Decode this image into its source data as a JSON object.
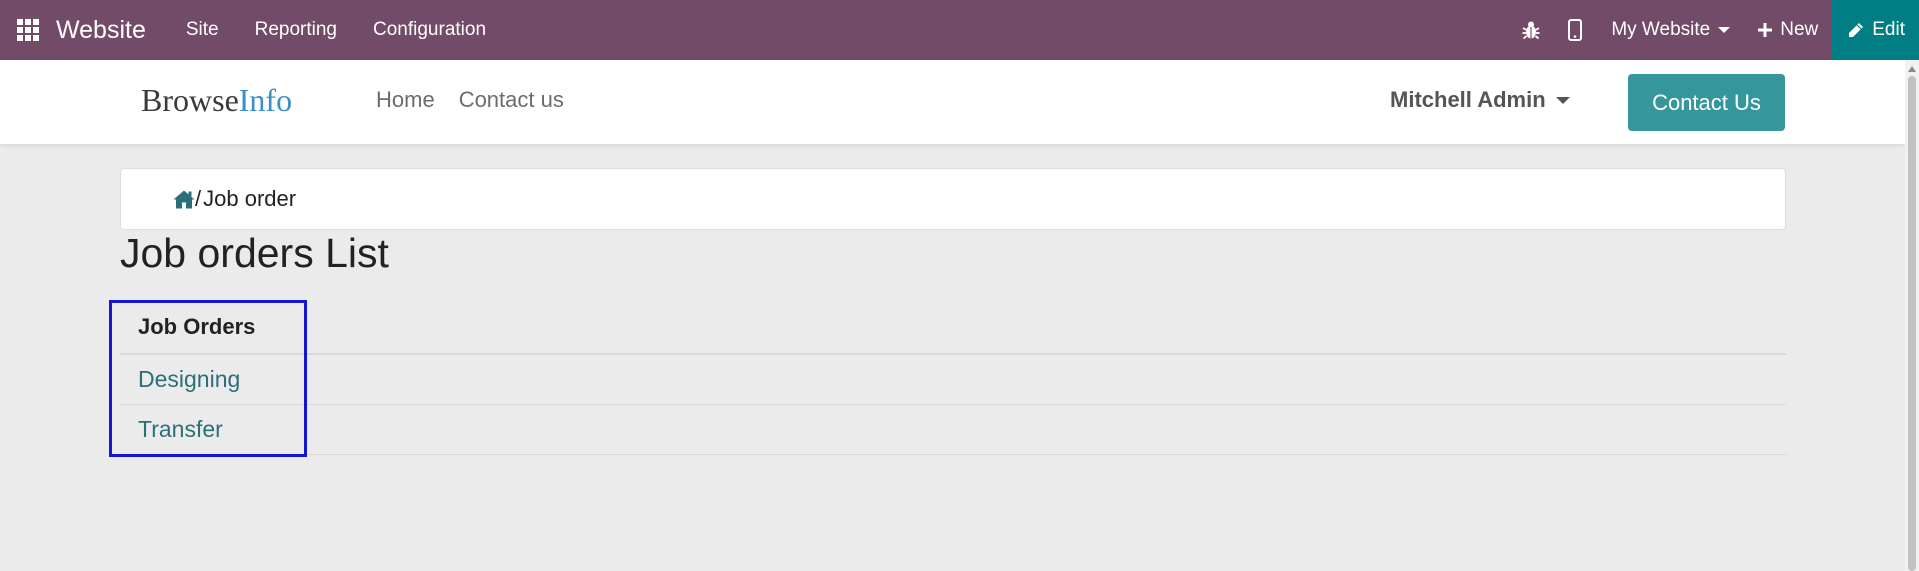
{
  "admin_bar": {
    "app_name": "Website",
    "menus": [
      "Site",
      "Reporting",
      "Configuration"
    ],
    "icons": {
      "apps": "apps-grid-icon",
      "debug": "bug-icon",
      "mobile": "mobile-icon",
      "new": "plus-icon",
      "edit": "pencil-icon"
    },
    "website_selector": "My Website",
    "new_label": "New",
    "edit_label": "Edit",
    "colors": {
      "background": "#714b67",
      "edit_background": "#017e84"
    }
  },
  "site_header": {
    "logo": {
      "part1": "Browse",
      "part2": "Info"
    },
    "nav": [
      "Home",
      "Contact us"
    ],
    "user_name": "Mitchell Admin",
    "cta_label": "Contact Us",
    "colors": {
      "cta": "#35979c",
      "logo_accent": "#3a8fc7"
    }
  },
  "breadcrumb": {
    "home_icon": "home-icon",
    "separator": "/",
    "current": "Job order"
  },
  "page": {
    "title": "Job orders List",
    "list_header": "Job Orders",
    "items": [
      "Designing",
      "Transfer"
    ]
  },
  "colors": {
    "link": "#2c6f78",
    "highlight_box": "#1515d6",
    "page_background": "#ebebeb"
  }
}
